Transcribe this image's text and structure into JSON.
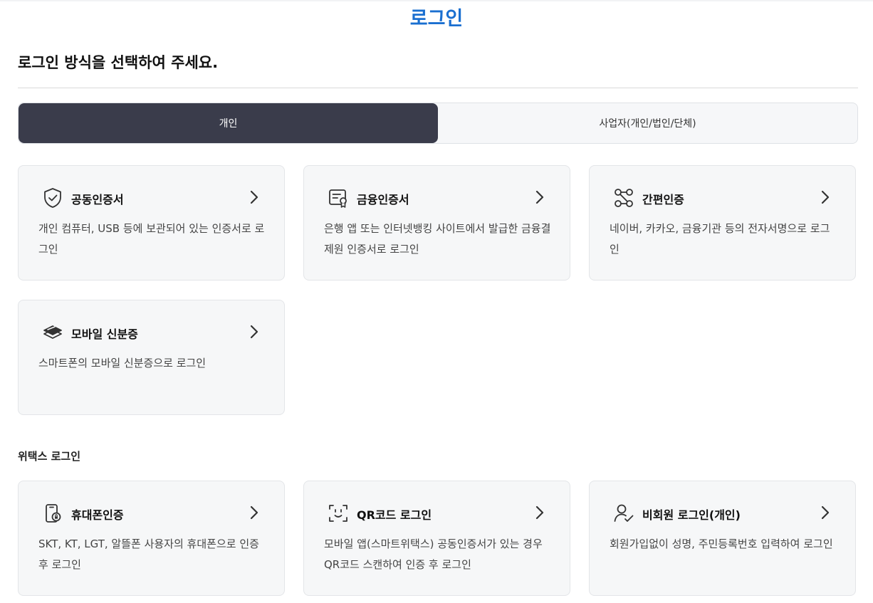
{
  "header": {
    "title": "로그인",
    "subtitle": "로그인 방식을 선택하여 주세요."
  },
  "tabs": [
    {
      "label": "개인",
      "active": true
    },
    {
      "label": "사업자(개인/법인/단체)",
      "active": false
    }
  ],
  "cards": [
    {
      "icon": "shield-check-icon",
      "title": "공동인증서",
      "desc": "개인 컴퓨터, USB 등에 보관되어 있는 인증서로 로그인"
    },
    {
      "icon": "certificate-icon",
      "title": "금융인증서",
      "desc": "은행 앱 또는 인터넷뱅킹 사이트에서 발급한 금융결제원 인증서로 로그인"
    },
    {
      "icon": "simple-auth-icon",
      "title": "간편인증",
      "desc": "네이버, 카카오, 금융기관 등의 전자서명으로 로그인"
    },
    {
      "icon": "mobile-id-icon",
      "title": "모바일 신분증",
      "desc": "스마트폰의 모바일 신분증으로 로그인"
    }
  ],
  "wetax": {
    "label": "위택스 로그인",
    "cards": [
      {
        "icon": "phone-auth-icon",
        "title": "휴대폰인증",
        "desc": "SKT, KT, LGT, 알뜰폰 사용자의 휴대폰으로 인증 후 로그인"
      },
      {
        "icon": "qr-scan-icon",
        "title": "QR코드 로그인",
        "desc": "모바일 앱(스마트위택스) 공동인증서가 있는 경우 QR코드 스캔하여 인증 후 로그인"
      },
      {
        "icon": "non-member-icon",
        "title": "비회원 로그인(개인)",
        "desc": "회원가입없이 성명, 주민등록번호 입력하여 로그인"
      }
    ]
  },
  "colors": {
    "accent": "#1a6fd0",
    "tab_active_bg": "#3a3c4b",
    "card_bg": "#f6f7f8"
  }
}
